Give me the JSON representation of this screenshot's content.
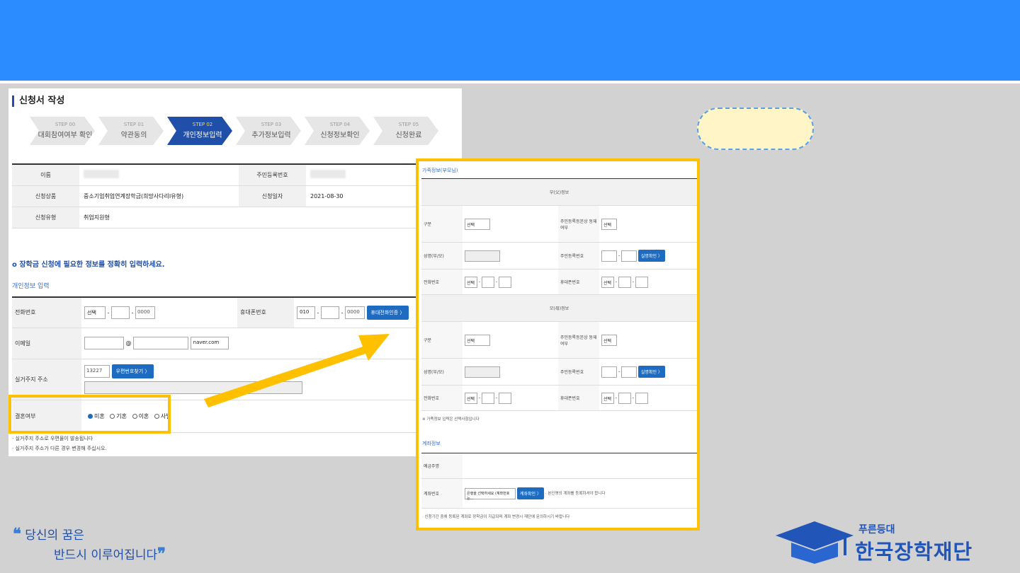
{
  "colors": {
    "banner": "#2b8cff",
    "highlight": "#ffc000",
    "accent": "#1f4fa8",
    "button": "#1e6bc2",
    "callout": "#fff5c6"
  },
  "panel": {
    "title": "신청서 작성",
    "steps": [
      {
        "num": "STEP 00",
        "label": "대회참여여부 확인"
      },
      {
        "num": "STEP 01",
        "label": "약관동의"
      },
      {
        "num": "STEP 02",
        "label": "개인정보입력"
      },
      {
        "num": "STEP 03",
        "label": "추가정보입력"
      },
      {
        "num": "STEP 04",
        "label": "신청정보확인"
      },
      {
        "num": "STEP 05",
        "label": "신청완료"
      }
    ],
    "info": {
      "name_label": "이름",
      "rrn_label": "주민등록번호",
      "product_label": "신청상품",
      "product_value": "중소기업취업연계장학금(희망사다리Ⅰ유형)",
      "date_label": "신청일자",
      "date_value": "2021-08-30",
      "type_label": "신청유형",
      "type_value": "취업지원형"
    },
    "guide": "o 장학금 신청에 필요한 정보를 정확히 입력하세요.",
    "section": "개인정보 입력",
    "form": {
      "phone_label": "전화번호",
      "phone_select": "선택",
      "phone_last": "0000",
      "mobile_label": "휴대폰번호",
      "mobile_first": "010",
      "mobile_last": "0000",
      "mobile_btn": "휴대전화인증 〉",
      "email_label": "이메일",
      "email_at": "@",
      "email_domain": "naver.com",
      "address_label": "실거주지 주소",
      "zip": "13227",
      "zip_btn": "우편번호찾기 〉",
      "marital_label": "결혼여부",
      "marital_options": [
        "미혼",
        "기혼",
        "이혼",
        "사별"
      ]
    },
    "notes": [
      "· 실거주지 주소로 우편물이 발송됩니다",
      "· 실거주지 주소가 다른 경우 변경해 주십시오."
    ]
  },
  "right": {
    "family_section": "가족정보(부모님)",
    "father_header": "부(父)정보",
    "mother_header": "모(母)정보",
    "type_label": "구분",
    "type_select": "선택",
    "resident_label": "주민등록등본상 동재여부",
    "resident_select": "선택",
    "name_label": "성명(부/모)",
    "rrn_label": "주민등록번호",
    "rrn_btn": "실명확인 〉",
    "phone_label": "전화번호",
    "mobile_label": "휴대폰번호",
    "sel": "선택",
    "family_note": "※ 가족정보 입력은 선택사항입니다",
    "account_section": "계좌정보",
    "holder_label": "예금주명",
    "bank_label": "계좌번호",
    "bank_select": "은행을 선택하세요 (계좌번호는...",
    "bank_btn": "계좌확인 〉",
    "bank_note": "· 본인명의 계좌를 등록하셔야 합니다",
    "account_note": "· 신청기간 중에 등록된 계좌로 장학금이 지급되며 계좌 변경시 재단에 문의하시기 바랍니다"
  },
  "slogan": {
    "open": "❝",
    "line1": "당신의 꿈은",
    "line2": "반드시 이루어집니다",
    "close": "❞"
  },
  "logo": {
    "small": "푸른등대",
    "big": "한국장학재단"
  }
}
